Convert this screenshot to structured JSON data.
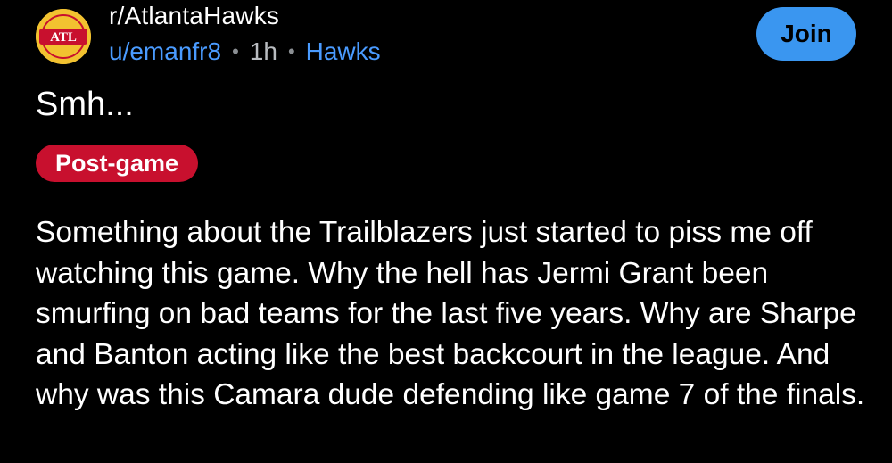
{
  "community": {
    "name": "r/AtlantaHawks",
    "avatar_text": "ATL",
    "avatar_icon": "atlanta-hawks-logo"
  },
  "meta": {
    "author": "u/emanfr8",
    "time": "1h",
    "flair": "Hawks",
    "separator": "•"
  },
  "join_button": {
    "label": "Join"
  },
  "post": {
    "title": "Smh...",
    "flair_tag": "Post-game",
    "body": "Something about the Trailblazers just started to piss me off watching this game. Why the hell has Jermi Grant been smurfing on bad teams for the last five years. Why are Sharpe and Banton acting like the best backcourt in the league. And why was this Camara dude defending like game 7 of the finals."
  },
  "colors": {
    "background": "#000000",
    "link": "#4a9bff",
    "join_button": "#3a96f0",
    "flair_tag": "#c8102e",
    "avatar": "#f2c230"
  }
}
